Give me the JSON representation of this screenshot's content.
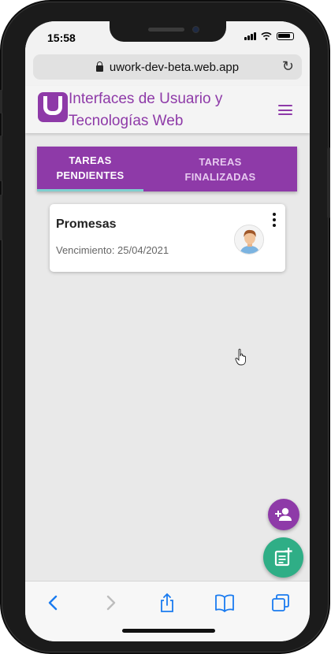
{
  "status_bar": {
    "time": "15:58"
  },
  "browser": {
    "url": "uwork-dev-beta.web.app"
  },
  "app": {
    "title": "Interfaces de Usuario y Tecnologías Web",
    "brand_color": "#8e3aa8",
    "accent_color": "#2fae86"
  },
  "tabs": [
    {
      "label": "TAREAS PENDIENTES",
      "active": true
    },
    {
      "label": "TAREAS FINALIZADAS",
      "active": false
    }
  ],
  "tasks": [
    {
      "title": "Promesas",
      "due": "Vencimiento: 25/04/2021",
      "avatar_icon": "user-avatar-icon"
    }
  ],
  "actions": {
    "add_user_icon": "person-add-icon",
    "add_task_icon": "note-add-icon"
  },
  "toolbar_icons": [
    "back-icon",
    "forward-icon",
    "share-icon",
    "bookmarks-icon",
    "tabs-icon"
  ]
}
